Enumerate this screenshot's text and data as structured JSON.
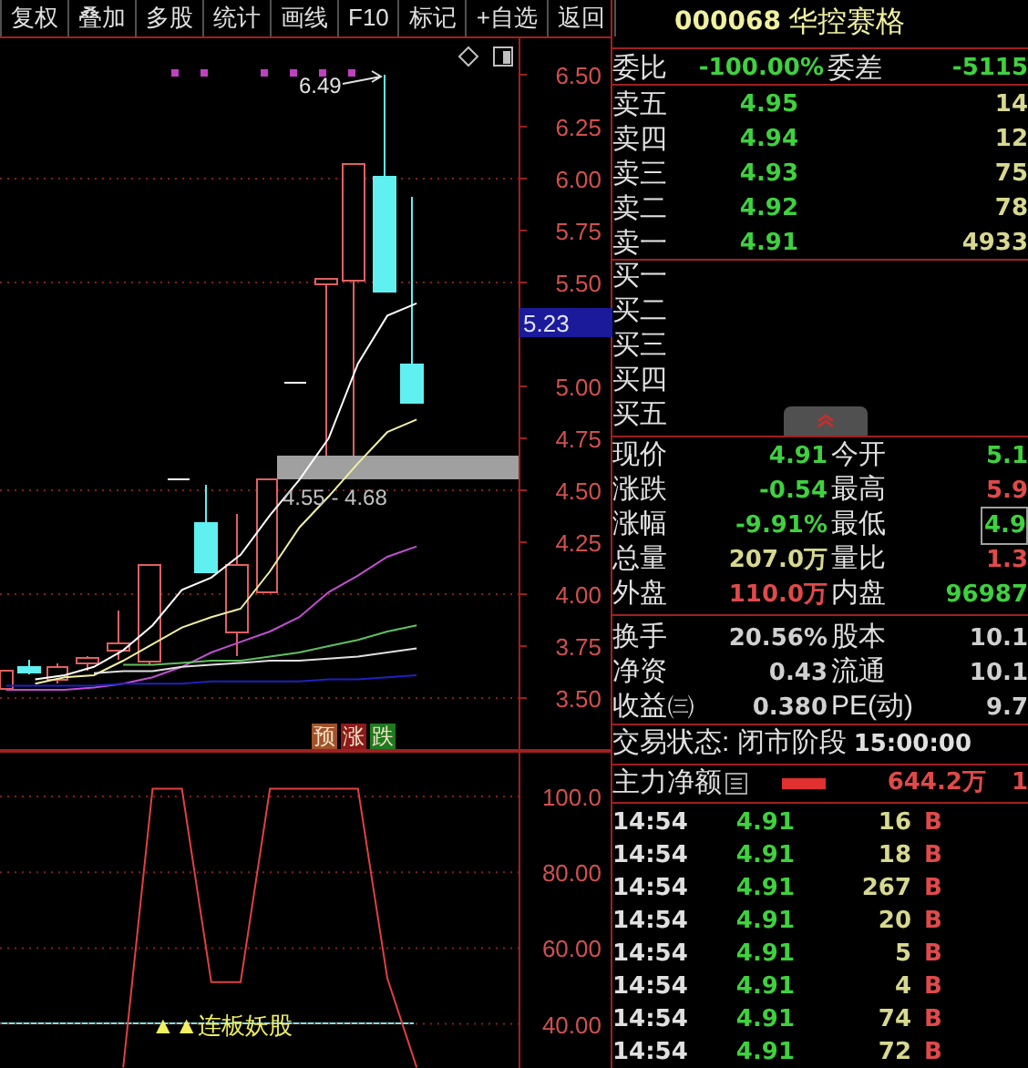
{
  "toolbar": {
    "buttons": [
      "复权",
      "叠加",
      "多股",
      "统计",
      "画线",
      "F10",
      "标记",
      "+自选",
      "返回"
    ]
  },
  "price_chart": {
    "chart_data": {
      "type": "line",
      "categories": [
        null,
        null,
        null,
        null,
        null,
        null,
        null,
        null,
        null,
        null,
        null,
        null,
        null,
        null,
        null
      ],
      "ylim": [
        3.246,
        6.675
      ],
      "grid": true,
      "yticks": [
        {
          "value": 6.5,
          "label": "6.50"
        },
        {
          "value": 6.25,
          "label": "6.25"
        },
        {
          "value": 6.0,
          "label": "6.00"
        },
        {
          "value": 5.75,
          "label": "5.75"
        },
        {
          "value": 5.5,
          "label": "5.50"
        },
        {
          "value": 5.0,
          "label": "5.00"
        },
        {
          "value": 4.75,
          "label": "4.75"
        },
        {
          "value": 4.5,
          "label": "4.50"
        },
        {
          "value": 4.25,
          "label": "4.25"
        },
        {
          "value": 4.0,
          "label": "4.00"
        },
        {
          "value": 3.75,
          "label": "3.75"
        },
        {
          "value": 3.5,
          "label": "3.50"
        }
      ],
      "series": [
        {
          "color": "#ffffff",
          "values": [
            null,
            3.59,
            3.61,
            3.65,
            3.73,
            3.85,
            4.02,
            4.08,
            4.19,
            4.38,
            4.55,
            4.75,
            5.11,
            5.34,
            5.4
          ]
        },
        {
          "color": "#f0f0a0",
          "values": [
            null,
            3.57,
            3.6,
            3.61,
            3.68,
            3.76,
            3.84,
            3.89,
            3.93,
            4.11,
            4.32,
            4.47,
            4.63,
            4.78,
            4.84
          ]
        },
        {
          "color": "#c050d0",
          "values": [
            3.54,
            3.54,
            3.54,
            3.55,
            3.57,
            3.6,
            3.65,
            3.72,
            3.77,
            3.82,
            3.89,
            4.01,
            4.09,
            4.18,
            4.23
          ]
        },
        {
          "color": "#60c060",
          "values": [
            null,
            null,
            null,
            null,
            3.66,
            3.66,
            3.67,
            3.68,
            3.68,
            3.7,
            3.72,
            3.75,
            3.78,
            3.82,
            3.85
          ]
        },
        {
          "color": "#e0e0e0",
          "values": [
            null,
            null,
            null,
            3.62,
            3.63,
            3.63,
            3.65,
            3.66,
            3.67,
            3.68,
            3.68,
            3.69,
            3.7,
            3.72,
            3.74
          ]
        },
        {
          "color": "#2020c0",
          "values": [
            3.56,
            3.56,
            3.56,
            3.56,
            3.57,
            3.57,
            3.57,
            3.58,
            3.58,
            3.58,
            3.58,
            3.59,
            3.59,
            3.6,
            3.61
          ]
        }
      ]
    },
    "current_price_tag": "5.23",
    "high_marker": "6.49",
    "zone_label": "4.55 - 4.68",
    "signal_tags": [
      {
        "text": "预",
        "color": "#a0522d"
      },
      {
        "text": "涨",
        "color": "#8b1a1a"
      },
      {
        "text": "跌",
        "color": "#1f7a1f"
      }
    ]
  },
  "indicator_chart": {
    "chart_data": {
      "type": "line",
      "categories": [
        null,
        null,
        null,
        null,
        null,
        null,
        null,
        null,
        null,
        null,
        null,
        null,
        null,
        null,
        null
      ],
      "ylim": [
        28.37,
        112.0
      ],
      "grid": true,
      "yticks": [
        {
          "value": 100,
          "label": "100.0"
        },
        {
          "value": 80,
          "label": "80.00"
        },
        {
          "value": 60,
          "label": "60.00"
        },
        {
          "value": 40,
          "label": "40.00"
        }
      ],
      "series": [
        {
          "color": "#e04040",
          "values": [
            null,
            null,
            null,
            null,
            28.5,
            102,
            102,
            51,
            51,
            102,
            102,
            102,
            102,
            52,
            28.5
          ]
        }
      ]
    },
    "signal_label": "▲▲连板妖股"
  },
  "quote": {
    "code": "000068",
    "name": "华控赛格",
    "committee": {
      "ratio_label": "委比",
      "ratio": "-100.00%",
      "diff_label": "委差",
      "diff": "-5115"
    },
    "asks": [
      {
        "label": "卖五",
        "price": "4.95",
        "volume": "14"
      },
      {
        "label": "卖四",
        "price": "4.94",
        "volume": "12"
      },
      {
        "label": "卖三",
        "price": "4.93",
        "volume": "75"
      },
      {
        "label": "卖二",
        "price": "4.92",
        "volume": "78"
      },
      {
        "label": "卖一",
        "price": "4.91",
        "volume": "4933"
      }
    ],
    "bids": [
      {
        "label": "买一"
      },
      {
        "label": "买二"
      },
      {
        "label": "买三"
      },
      {
        "label": "买四"
      },
      {
        "label": "买五"
      }
    ],
    "stats": [
      {
        "label": "现价",
        "value": "4.91",
        "color": "#3fd13f",
        "boxed": false
      },
      {
        "label": "今开",
        "value": "5.1",
        "color": "#3fd13f",
        "boxed": false
      },
      {
        "label": "涨跌",
        "value": "-0.54",
        "color": "#3fd13f",
        "boxed": false
      },
      {
        "label": "最高",
        "value": "5.9",
        "color": "#e04a4a",
        "boxed": false
      },
      {
        "label": "涨幅",
        "value": "-9.91%",
        "color": "#3fd13f",
        "boxed": false
      },
      {
        "label": "最低",
        "value": "4.9",
        "color": "#3fd13f",
        "boxed": true
      },
      {
        "label": "总量",
        "value": "207.0万",
        "color": "#d8d890",
        "boxed": false
      },
      {
        "label": "量比",
        "value": "1.3",
        "color": "#e04a4a",
        "boxed": false
      },
      {
        "label": "外盘",
        "value": "110.0万",
        "color": "#e04a4a",
        "boxed": false
      },
      {
        "label": "内盘",
        "value": "96987",
        "color": "#3fd13f",
        "boxed": false
      }
    ],
    "fundamentals": [
      {
        "label": "换手",
        "value": "20.56%",
        "label2": "股本",
        "value2": "10.1"
      },
      {
        "label": "净资",
        "value": "0.43",
        "label2": "流通",
        "value2": "10.1"
      },
      {
        "label": "收益㈢",
        "value": "0.380",
        "label2": "PE(动)",
        "value2": "9.7"
      }
    ],
    "status_label": "交易状态: 闭市阶段",
    "status_time": "15:00:00",
    "main_flow": {
      "label": "主力净额",
      "value": "644.2万",
      "value2": "1"
    },
    "trades": [
      {
        "time": "14:54",
        "price": "4.91",
        "volume": "16",
        "side": "B"
      },
      {
        "time": "14:54",
        "price": "4.91",
        "volume": "18",
        "side": "B"
      },
      {
        "time": "14:54",
        "price": "4.91",
        "volume": "267",
        "side": "B"
      },
      {
        "time": "14:54",
        "price": "4.91",
        "volume": "20",
        "side": "B"
      },
      {
        "time": "14:54",
        "price": "4.91",
        "volume": "5",
        "side": "B"
      },
      {
        "time": "14:54",
        "price": "4.91",
        "volume": "4",
        "side": "B"
      },
      {
        "time": "14:54",
        "price": "4.91",
        "volume": "74",
        "side": "B"
      },
      {
        "time": "14:54",
        "price": "4.91",
        "volume": "72",
        "side": "B"
      }
    ]
  }
}
